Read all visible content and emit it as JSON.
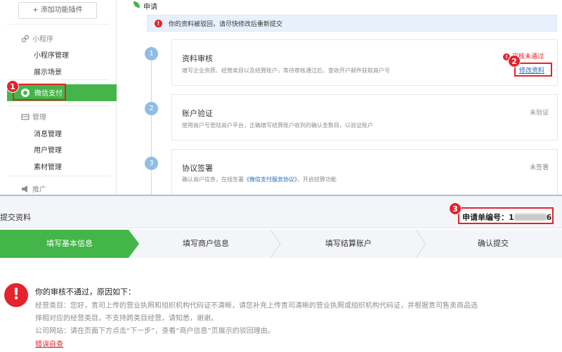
{
  "sidebar": {
    "add_plugin": "+ 添加功能插件",
    "mini_program_group": "小程序",
    "mini_program_items": [
      "小程序管理",
      "展示场景"
    ],
    "wechat_pay": "微信支付",
    "manage_group": "管理",
    "manage_items": [
      "消息管理",
      "用户管理",
      "素材管理"
    ],
    "promote_group": "推广"
  },
  "content": {
    "page_title": "申请",
    "notice": "你的资料被驳回，请尽快修改后重新提交",
    "steps": [
      {
        "num": "1",
        "title": "资料审核",
        "desc": "填写企业资质、经营类目以及结算账户，等待审核通过后，查收开户邮件获取商户号",
        "status": "审核未通过",
        "action": "修改资料"
      },
      {
        "num": "2",
        "title": "账户验证",
        "desc": "使用商户号登陆商户平台，正确填写结算账户收到的确认金数目，以验证账户",
        "status": "未验证"
      },
      {
        "num": "3",
        "title": "协议签署",
        "desc_prefix": "确认商户信息，在线签署",
        "desc_link": "《微信支付服务协议》",
        "desc_suffix": "，开启结算功能",
        "status": "未签署"
      }
    ]
  },
  "bottom": {
    "title": "提交资料",
    "order_label": "申请单编号：1",
    "order_suffix": "6",
    "progress_steps": [
      "填写基本信息",
      "填写商户信息",
      "填写结算账户",
      "确认提交"
    ],
    "reject_title": "你的审核不通过，原因如下：",
    "reject_lines": [
      "经营类目：您好，贵司上传的营业执照和组织机构代码证不清晰，请您补充上传贵司清晰的营业执照或组织机构代码证，并根据贵司售卖商品选",
      "择相对应的经营类目，不支持跨类目经营，请知悉，谢谢。",
      "公司网站：请在页面下方点击“下一步”，查看“商户信息”页展示的驳回理由。"
    ],
    "error_link": "错误自查"
  },
  "annotations": [
    "1",
    "2",
    "3"
  ],
  "colors": {
    "accent": "#44b549",
    "error": "#e6222c",
    "step_blue": "#8fbde6",
    "link": "#1e6bb8"
  }
}
